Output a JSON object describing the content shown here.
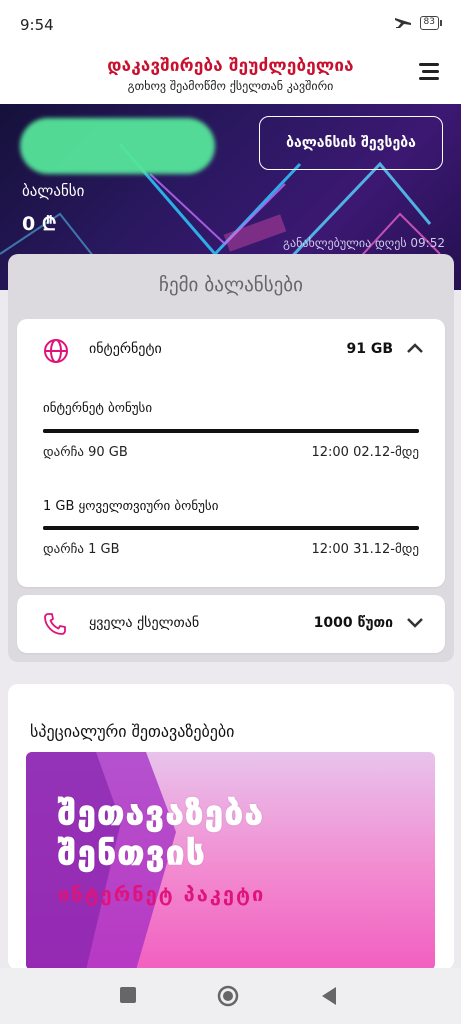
{
  "status": {
    "time": "9:54",
    "battery": "83"
  },
  "header": {
    "title": "დაკავშირება შეუძლებელია",
    "subtitle": "გთხოვ შეამოწმო ქსელთან კავშირი"
  },
  "hero": {
    "balance_label": "ბალანსი",
    "balance_value": "0 ₾",
    "topup_label": "ბალანსის შევსება",
    "updated": "განახლებულია დღეს 09:52"
  },
  "balances": {
    "title": "ჩემი ბალანსები",
    "internet": {
      "label": "ინტერნეტი",
      "value": "91 GB",
      "bonuses": [
        {
          "title": "ინტერნეტ ბონუსი",
          "remaining": "დარჩა 90 GB",
          "until": "12:00 02.12-მდე",
          "fill": 1.0
        },
        {
          "title": "1 GB ყოველთვიური ბონუსი",
          "remaining": "დარჩა 1 GB",
          "until": "12:00 31.12-მდე",
          "fill": 1.0
        }
      ]
    },
    "calls": {
      "label": "ყველა ქსელთან",
      "value": "1000 წუთი"
    }
  },
  "offers": {
    "title": "სპეციალური შეთავაზებები",
    "banner": {
      "line1": "შეთავაზება",
      "line2": "შენთვის",
      "line3": "ინტერნეტ პაკეტი"
    }
  },
  "colors": {
    "brand_red": "#c8102e",
    "accent_pink": "#e0137a",
    "hero_bg": "#2a1860"
  }
}
